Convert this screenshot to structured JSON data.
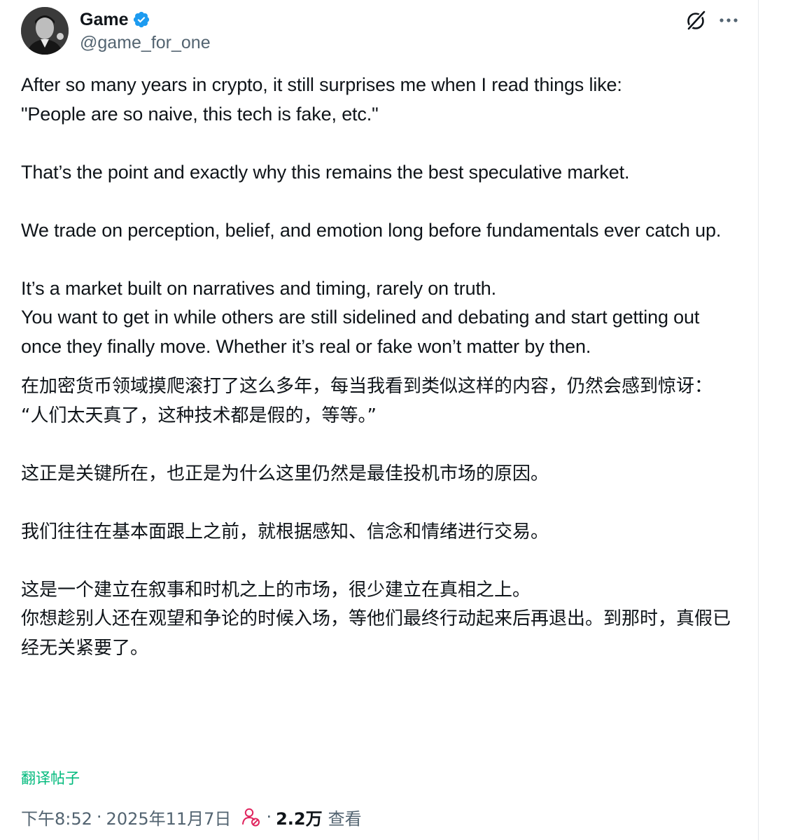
{
  "author": {
    "display_name": "Game",
    "handle": "@game_for_one",
    "verified": true,
    "verified_color": "#1d9bf0"
  },
  "header_actions": {
    "grok_icon": "grok-icon",
    "more_icon": "more-horizontal-icon"
  },
  "post": {
    "english_paragraphs": [
      "After so many years in crypto, it still surprises me when I read things like:\n\"People are so naive, this tech is fake, etc.\"",
      "That’s the point and exactly why this remains the best speculative market.",
      "We trade on perception, belief, and emotion long before fundamentals ever catch up.",
      "It’s a market built on narratives and timing, rarely on truth.\nYou want to get in while others are still sidelined and debating and start getting out once they finally move. Whether it’s real or fake won’t matter by then."
    ],
    "chinese_paragraphs": [
      "在加密货币领域摸爬滚打了这么多年，每当我看到类似这样的内容，仍然会感到惊讶：\n“人们太天真了，这种技术都是假的，等等。”",
      "这正是关键所在，也正是为什么这里仍然是最佳投机市场的原因。",
      "我们往往在基本面跟上之前，就根据感知、信念和情绪进行交易。",
      "这是一个建立在叙事和时机之上的市场，很少建立在真相之上。\n你想趁别人还在观望和争论的时候入场，等他们最终行动起来后再退出。到那时，真假已经无关紧要了。"
    ],
    "translate_label": "翻译帖子",
    "translate_color": "#00ba7c"
  },
  "meta": {
    "time": "下午8:52",
    "separator": "·",
    "date": "2025年11月7日",
    "views_count": "2.2万",
    "views_label": "查看",
    "views_icon": "analytics-person-icon"
  },
  "colors": {
    "text": "#0f1419",
    "secondary": "#536471"
  }
}
